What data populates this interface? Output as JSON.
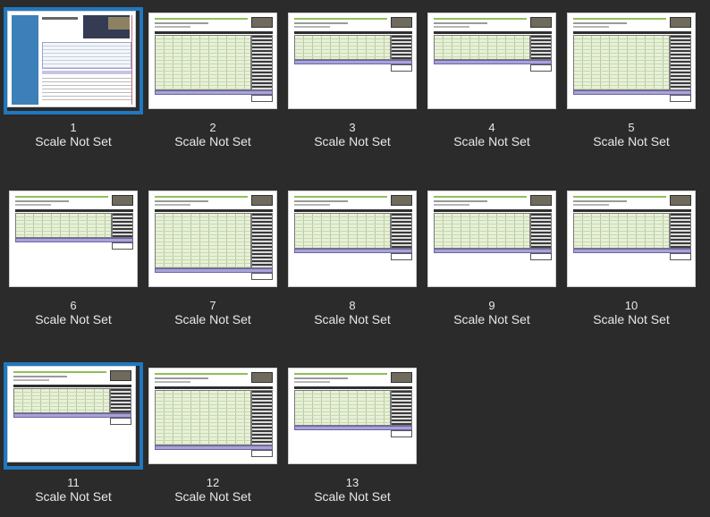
{
  "pages": [
    {
      "number": "1",
      "scale": "Scale Not Set",
      "selected": true
    },
    {
      "number": "2",
      "scale": "Scale Not Set",
      "selected": false
    },
    {
      "number": "3",
      "scale": "Scale Not Set",
      "selected": false
    },
    {
      "number": "4",
      "scale": "Scale Not Set",
      "selected": false
    },
    {
      "number": "5",
      "scale": "Scale Not Set",
      "selected": false
    },
    {
      "number": "6",
      "scale": "Scale Not Set",
      "selected": false
    },
    {
      "number": "7",
      "scale": "Scale Not Set",
      "selected": false
    },
    {
      "number": "8",
      "scale": "Scale Not Set",
      "selected": false
    },
    {
      "number": "9",
      "scale": "Scale Not Set",
      "selected": false
    },
    {
      "number": "10",
      "scale": "Scale Not Set",
      "selected": false
    },
    {
      "number": "11",
      "scale": "Scale Not Set",
      "selected": true
    },
    {
      "number": "12",
      "scale": "Scale Not Set",
      "selected": false
    },
    {
      "number": "13",
      "scale": "Scale Not Set",
      "selected": false
    }
  ],
  "colors": {
    "background": "#2b2b2b",
    "selection": "#1f78c0",
    "label_text": "#e8e8e8"
  }
}
